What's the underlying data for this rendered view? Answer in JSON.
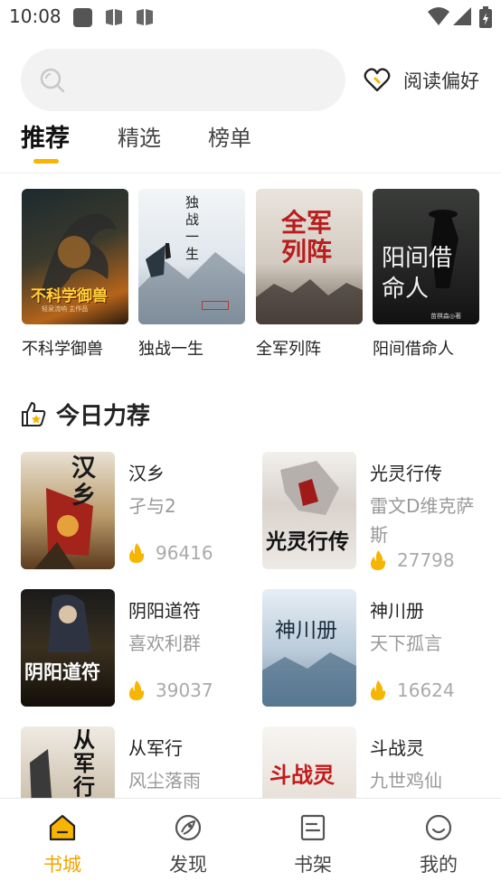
{
  "status_bar": {
    "time": "10:08"
  },
  "search": {
    "placeholder": ""
  },
  "preference": {
    "label": "阅读偏好"
  },
  "tabs": [
    {
      "label": "推荐",
      "active": true
    },
    {
      "label": "精选",
      "active": false
    },
    {
      "label": "榜单",
      "active": false
    }
  ],
  "recommended": [
    {
      "title": "不科学御兽",
      "cover_text": "不科学御兽",
      "cover_sub": "轻泉流响 主作品"
    },
    {
      "title": "独战一生",
      "cover_text": "独战一生",
      "cover_sub": ""
    },
    {
      "title": "全军列阵",
      "cover_text": "全军列阵",
      "cover_sub": ""
    },
    {
      "title": "阳间借命人",
      "cover_text": "阳间借命人",
      "cover_sub": "苗棋森◎著"
    }
  ],
  "section": {
    "title": "今日力荐"
  },
  "daily": [
    {
      "title": "汉乡",
      "author": "孑与2",
      "heat": "96416",
      "cover_text": "汉乡"
    },
    {
      "title": "光灵行传",
      "author": "雷文D维克萨斯",
      "heat": "27798",
      "cover_text": "光灵行传"
    },
    {
      "title": "阴阳道符",
      "author": "喜欢利群",
      "heat": "39037",
      "cover_text": "阴阳道符"
    },
    {
      "title": "神川册",
      "author": "天下孤言",
      "heat": "16624",
      "cover_text": "神川册"
    },
    {
      "title": "从军行",
      "author": "风尘落雨",
      "heat": "",
      "cover_text": "从军行"
    },
    {
      "title": "斗战灵",
      "author": "九世鸡仙",
      "heat": "",
      "cover_text": "斗战灵"
    }
  ],
  "bottom_nav": [
    {
      "label": "书城",
      "icon": "home-icon",
      "active": true
    },
    {
      "label": "发现",
      "icon": "discover-icon",
      "active": false
    },
    {
      "label": "书架",
      "icon": "bookshelf-icon",
      "active": false
    },
    {
      "label": "我的",
      "icon": "profile-icon",
      "active": false
    }
  ],
  "colors": {
    "accent": "#f7b500",
    "nav_active": "#f2a500",
    "muted": "#999999"
  }
}
